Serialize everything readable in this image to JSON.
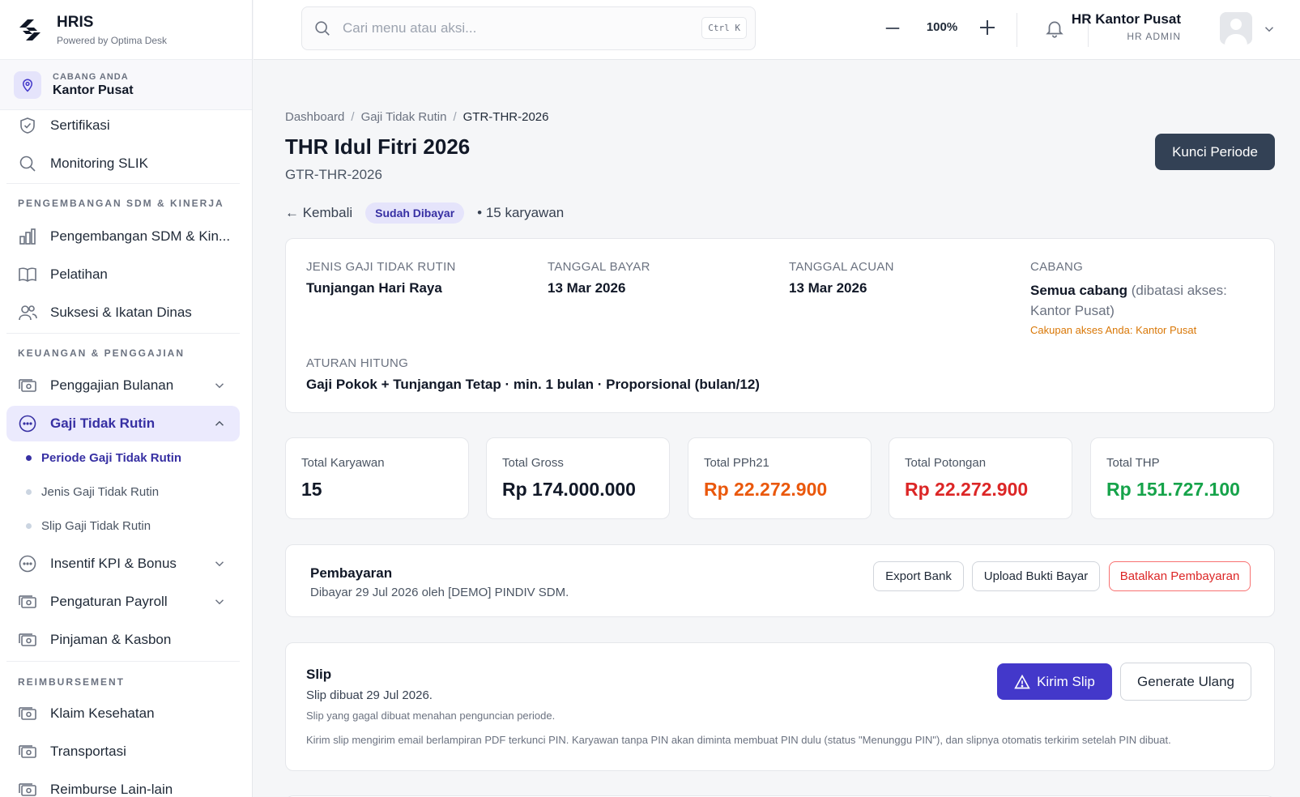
{
  "brand": {
    "name": "HRIS",
    "tagline": "Powered by Optima Desk"
  },
  "branch": {
    "label": "CABANG ANDA",
    "name": "Kantor Pusat"
  },
  "sidebar": {
    "items_top": [
      {
        "label": "Sertifikasi",
        "icon": "shield-check-icon"
      },
      {
        "label": "Monitoring SLIK",
        "icon": "search-icon"
      }
    ],
    "section_hr": "PENGEMBANGAN SDM & KINERJA",
    "items_hr": [
      {
        "label": "Pengembangan SDM & Kin...",
        "icon": "bar-chart-icon"
      },
      {
        "label": "Pelatihan",
        "icon": "book-icon"
      },
      {
        "label": "Suksesi & Ikatan Dinas",
        "icon": "users-icon"
      }
    ],
    "section_fin": "KEUANGAN & PENGGAJIAN",
    "items_fin": [
      {
        "label": "Penggajian Bulanan",
        "icon": "money-icon"
      },
      {
        "label": "Gaji Tidak Rutin",
        "icon": "more-circle-icon"
      },
      {
        "label": "Insentif KPI & Bonus",
        "icon": "more-circle-icon"
      },
      {
        "label": "Pengaturan Payroll",
        "icon": "money-icon"
      },
      {
        "label": "Pinjaman & Kasbon",
        "icon": "money-icon"
      }
    ],
    "sub_items": [
      {
        "label": "Periode Gaji Tidak Rutin"
      },
      {
        "label": "Jenis Gaji Tidak Rutin"
      },
      {
        "label": "Slip Gaji Tidak Rutin"
      }
    ],
    "section_reimb": "REIMBURSEMENT",
    "items_reimb": [
      {
        "label": "Klaim Kesehatan",
        "icon": "money-icon"
      },
      {
        "label": "Transportasi",
        "icon": "money-icon"
      },
      {
        "label": "Reimburse Lain-lain",
        "icon": "money-icon"
      }
    ]
  },
  "topbar": {
    "search_placeholder": "Cari menu atau aksi...",
    "shortcut": "Ctrl K",
    "zoom": "100%",
    "user_name": "HR Kantor Pusat",
    "user_role": "HR ADMIN"
  },
  "breadcrumb": [
    "Dashboard",
    "Gaji Tidak Rutin",
    "GTR-THR-2026"
  ],
  "page": {
    "title": "THR Idul Fitri 2026",
    "code": "GTR-THR-2026",
    "lock_button": "Kunci Periode",
    "back": "← Kembali",
    "status": "Sudah Dibayar",
    "employee_count": "• 15 karyawan"
  },
  "info": {
    "type_label": "JENIS GAJI TIDAK RUTIN",
    "type_value": "Tunjangan Hari Raya",
    "pay_date_label": "TANGGAL BAYAR",
    "pay_date_value": "13 Mar 2026",
    "ref_date_label": "TANGGAL ACUAN",
    "ref_date_value": "13 Mar 2026",
    "branch_label": "CABANG",
    "branch_value": "Semua cabang",
    "branch_note": " (dibatasi akses:",
    "branch_note2": "Kantor Pusat)",
    "scope_note": "Cakupan akses Anda: Kantor Pusat",
    "rule_label": "ATURAN HITUNG",
    "rule_value": "Gaji Pokok + Tunjangan Tetap · min. 1 bulan · Proporsional (bulan/12)"
  },
  "stats": [
    {
      "label": "Total Karyawan",
      "value": "15",
      "color": "#111827"
    },
    {
      "label": "Total Gross",
      "value": "Rp 174.000.000",
      "color": "#111827"
    },
    {
      "label": "Total PPh21",
      "value": "Rp 22.272.900",
      "color": "#ea580c"
    },
    {
      "label": "Total Potongan",
      "value": "Rp 22.272.900",
      "color": "#dc2626"
    },
    {
      "label": "Total THP",
      "value": "Rp 151.727.100",
      "color": "#16a34a"
    }
  ],
  "payment": {
    "title": "Pembayaran",
    "desc": "Dibayar 29 Jul 2026 oleh [DEMO] PINDIV SDM.",
    "export_button": "Export Bank",
    "upload_button": "Upload Bukti Bayar",
    "cancel_button": "Batalkan Pembayaran"
  },
  "slip": {
    "title": "Slip",
    "created": "Slip dibuat 29 Jul 2026.",
    "note1": "Slip yang gagal dibuat menahan penguncian periode.",
    "note2": "Kirim slip mengirim email berlampiran PDF terkunci PIN. Karyawan tanpa PIN akan diminta membuat PIN dulu (status \"Menunggu PIN\"), dan slipnya otomatis terkirim setelah PIN dibuat.",
    "send_button": "Kirim Slip",
    "regen_button": "Generate Ulang"
  }
}
